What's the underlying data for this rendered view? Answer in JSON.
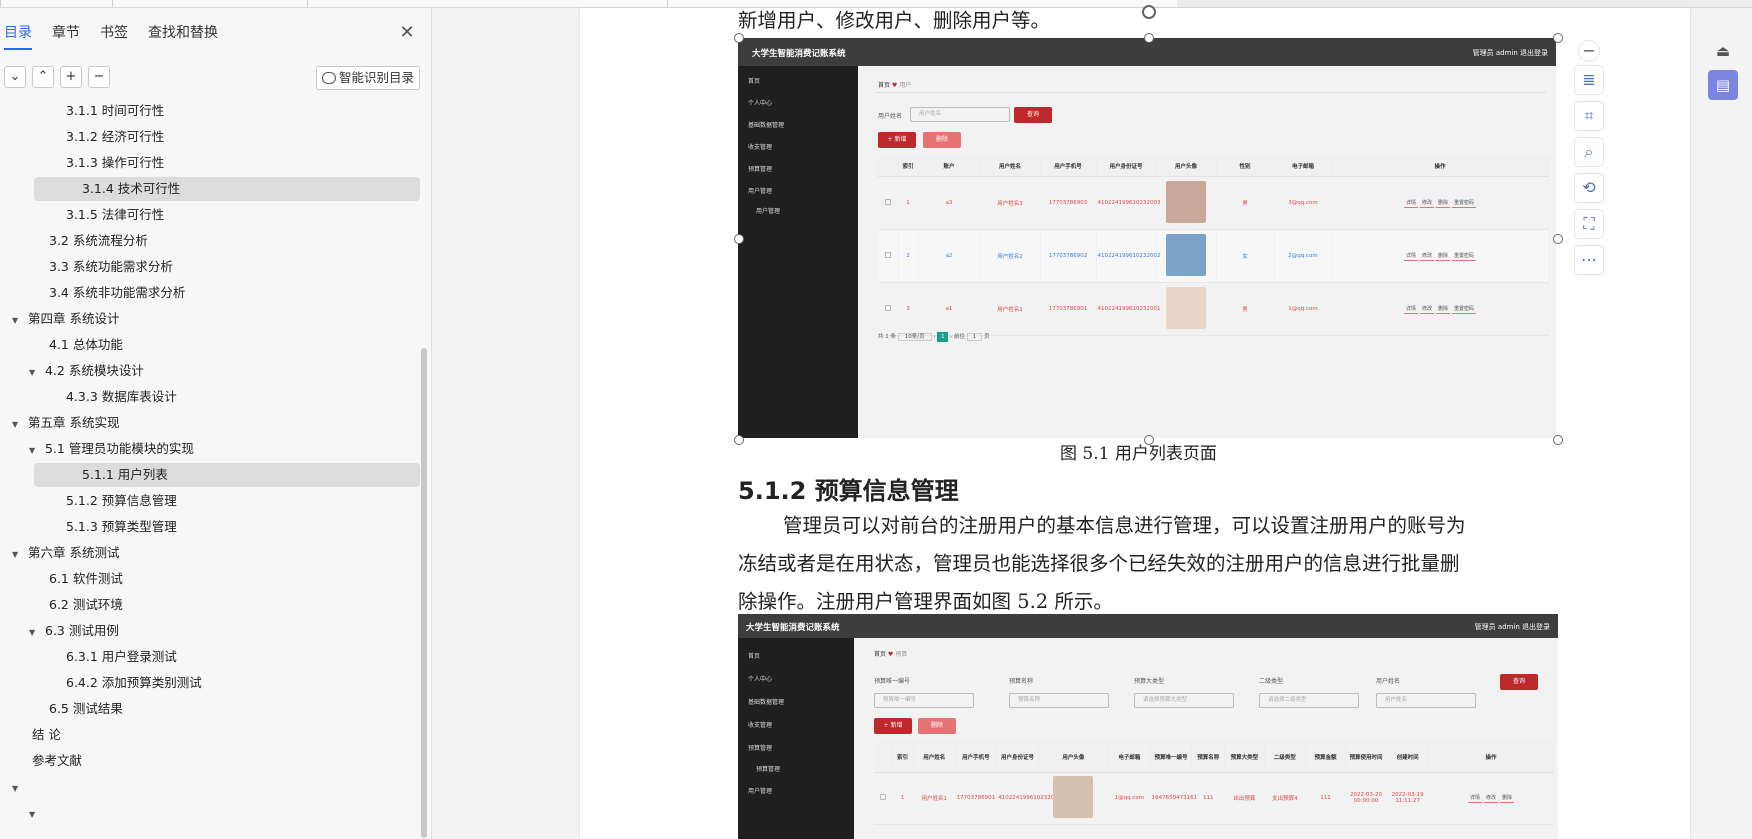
{
  "sidebar": {
    "tabs": [
      "目录",
      "章节",
      "书签",
      "查找和替换"
    ],
    "smart_button": "智能识别目录",
    "toc": [
      {
        "label": "3.1.1 时间可行性",
        "level": 3
      },
      {
        "label": "3.1.2  经济可行性",
        "level": 3
      },
      {
        "label": "3.1.3  操作可行性",
        "level": 3
      },
      {
        "label": "3.1.4  技术可行性",
        "level": 3,
        "highlight": true
      },
      {
        "label": "3.1.5  法律可行性",
        "level": 3
      },
      {
        "label": "3.2 系统流程分析",
        "level": 2
      },
      {
        "label": "3.3 系统功能需求分析",
        "level": 2
      },
      {
        "label": "3.4 系统非功能需求分析",
        "level": 2
      },
      {
        "label": "第四章  系统设计",
        "level": 1,
        "expander": true
      },
      {
        "label": "4.1  总体功能",
        "level": 2
      },
      {
        "label": "4.2  系统模块设计",
        "level": 2,
        "expander": true
      },
      {
        "label": "4.3.3  数据库表设计",
        "level": 3
      },
      {
        "label": "第五章  系统实现",
        "level": 1,
        "expander": true
      },
      {
        "label": "5.1  管理员功能模块的实现",
        "level": 2,
        "expander": true
      },
      {
        "label": "5.1.1  用户列表",
        "level": 3,
        "highlight": true
      },
      {
        "label": "5.1.2  预算信息管理",
        "level": 3
      },
      {
        "label": "5.1.3  预算类型管理",
        "level": 3
      },
      {
        "label": "第六章  系统测试",
        "level": 1,
        "expander": true
      },
      {
        "label": "6.1 软件测试",
        "level": 2
      },
      {
        "label": "6.2 测试环境",
        "level": 2
      },
      {
        "label": "6.3  测试用例",
        "level": 2,
        "expander": true
      },
      {
        "label": "6.3.1  用户登录测试",
        "level": 3
      },
      {
        "label": "6.4.2  添加预算类别测试",
        "level": 3
      },
      {
        "label": "6.5 测试结果",
        "level": 2
      },
      {
        "label": "结  论",
        "level": 1
      },
      {
        "label": "参考文献",
        "level": 1
      },
      {
        "label": "",
        "level": 1,
        "expander": true
      },
      {
        "label": "",
        "level": 2,
        "expander": true
      }
    ]
  },
  "doc": {
    "top_line": "新增用户、修改用户、删除用户等。",
    "caption1": "图 5.1  用户列表页面",
    "heading": "5.1.2  预算信息管理",
    "para_lines": [
      "管理员可以对前台的注册用户的基本信息进行管理，可以设置注册用户的账号为",
      "冻结或者是在用状态，管理员也能选择很多个已经失效的注册用户的信息进行批量删",
      "除操作。注册用户管理界面如图 5.2 所示。"
    ]
  },
  "fig1": {
    "app_title": "大学生智能消费记账系统",
    "top_right": "管理员 admin    退出登录",
    "menu": [
      "首页",
      "个人中心",
      "基础数据管理",
      "收支管理",
      "预算管理",
      "用户管理",
      "用户管理"
    ],
    "crumb_home": "首页",
    "crumb_page": "用户",
    "search_label": "用户姓名",
    "search_placeholder": "用户姓名",
    "search_btn": "查询",
    "add_btn": "+ 新增",
    "delete_btn": "删除",
    "columns": [
      "",
      "索引",
      "账户",
      "用户姓名",
      "用户手机号",
      "用户身份证号",
      "用户头像",
      "性别",
      "电子邮箱",
      "操作"
    ],
    "rows": [
      {
        "idx": "1",
        "account": "a3",
        "name": "用户姓名3",
        "phone": "17703786903",
        "idcard": "410224199610232003",
        "gender": "男",
        "email": "3@qq.com",
        "avatar_color": "#c9a79b"
      },
      {
        "idx": "2",
        "account": "a2",
        "name": "用户姓名2",
        "phone": "17703786902",
        "idcard": "410224199610232002",
        "gender": "女",
        "email": "2@qq.com",
        "avatar_color": "#7ba3c7"
      },
      {
        "idx": "3",
        "account": "a1",
        "name": "用户姓名1",
        "phone": "17703786901",
        "idcard": "410224199610232001",
        "gender": "男",
        "email": "1@qq.com",
        "avatar_color": "#e8d5c7"
      }
    ],
    "ops": [
      "详情",
      "修改",
      "删除",
      "重置密码"
    ],
    "pager_total": "共 1 条",
    "pager_size": "10条/页",
    "pager_page": "1",
    "pager_goto": "前往",
    "pager_goto_val": "1",
    "pager_unit": "页"
  },
  "fig2": {
    "app_title": "大学生智能消费记账系统",
    "top_right": "管理员 admin    退出登录",
    "menu": [
      "首页",
      "个人中心",
      "基础数据管理",
      "收支管理",
      "预算管理",
      "预算管理",
      "用户管理"
    ],
    "crumb_home": "首页",
    "crumb_page": "预算",
    "filters": [
      {
        "label": "预算唯一编号",
        "placeholder": "预算唯一编号"
      },
      {
        "label": "预算名称",
        "placeholder": "预算名称"
      },
      {
        "label": "预算大类型",
        "placeholder": "请选择预算大类型"
      },
      {
        "label": "二级类型",
        "placeholder": "请选择二级类型"
      },
      {
        "label": "用户姓名",
        "placeholder": "用户姓名"
      }
    ],
    "search_btn": "查询",
    "add_btn": "+ 新增",
    "delete_btn": "删除",
    "columns": [
      "",
      "索引",
      "用户姓名",
      "用户手机号",
      "用户身份证号",
      "用户头像",
      "电子邮箱",
      "预算唯一编号",
      "预算名称",
      "预算大类型",
      "二级类型",
      "预算金额",
      "预算使用时间",
      "创建时间",
      "操作"
    ],
    "row": {
      "idx": "1",
      "name": "用户姓名1",
      "phone": "17703786901",
      "idcard": "410224199610232001",
      "email": "1@qq.com",
      "code": "1647659473161",
      "bname": "111",
      "btype": "出出预算",
      "sub": "支出预算4",
      "amount": "111",
      "usetime": "2022-03-20 00:00:00",
      "ctime": "2022-03-19 11:11:27",
      "avatar_color": "#d8c0b0"
    },
    "ops": [
      "详情",
      "修改",
      "删除"
    ]
  },
  "colors": {
    "accent": "#2b6de0",
    "red": "#c0292b",
    "green": "#16a085",
    "dark": "#3d3d3d"
  }
}
